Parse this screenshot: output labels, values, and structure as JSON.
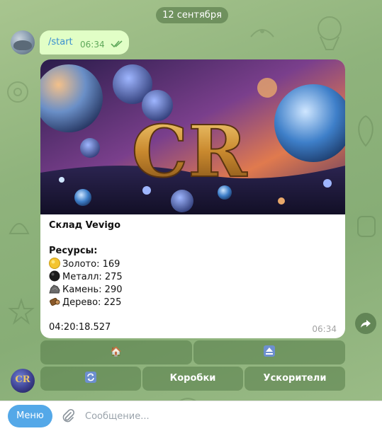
{
  "chat": {
    "date": "12 сентября",
    "outgoing": {
      "text": "/start",
      "time": "06:34"
    },
    "bot_message": {
      "title": "Склад Vevigo",
      "resources_header": "Ресурсы:",
      "resources": [
        {
          "icon": "gold-coin-icon",
          "label": "Золото: 169"
        },
        {
          "icon": "metal-ball-icon",
          "label": "Металл: 275"
        },
        {
          "icon": "rock-icon",
          "label": "Камень: 290"
        },
        {
          "icon": "wood-icon",
          "label": "Дерево: 225"
        }
      ],
      "timer": "04:20:18.527",
      "time": "06:34",
      "image_logo": "CR"
    }
  },
  "keyboard": {
    "row1": [
      {
        "icon": "house-icon",
        "glyph": "🏠"
      },
      {
        "icon": "eject-icon",
        "glyph": "⏏"
      }
    ],
    "row2": [
      {
        "icon": "refresh-icon",
        "glyph": "🔄"
      },
      {
        "label": "Коробки"
      },
      {
        "label": "Ускорители"
      }
    ]
  },
  "bot_avatar": {
    "text": "CR"
  },
  "input_bar": {
    "menu_label": "Меню",
    "placeholder": "Сообщение..."
  },
  "colors": {
    "accent": "#54a8e8",
    "outgoing_bubble": "#e1fec6",
    "chat_background": "#8fb37c"
  }
}
